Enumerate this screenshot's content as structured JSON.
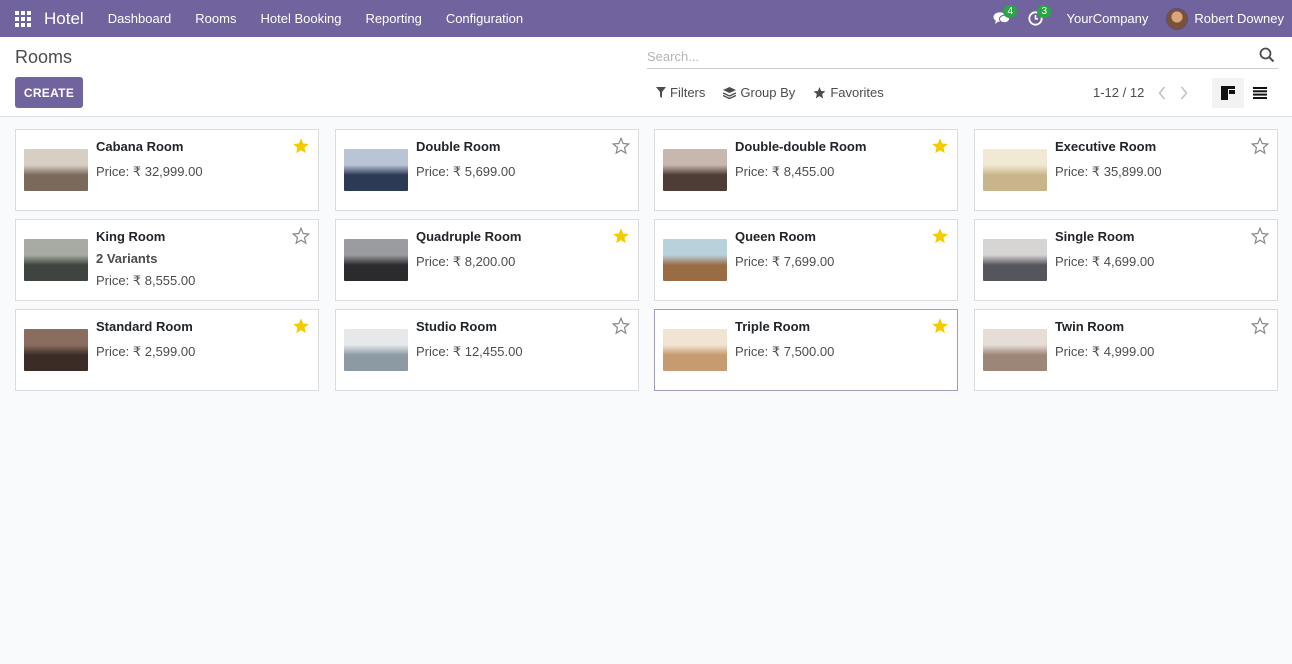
{
  "navbar": {
    "app_name": "Hotel",
    "menu": [
      "Dashboard",
      "Rooms",
      "Hotel Booking",
      "Reporting",
      "Configuration"
    ],
    "messages_count": "4",
    "activities_count": "3",
    "company": "YourCompany",
    "user": "Robert Downey",
    "accent_color": "#71639e"
  },
  "control": {
    "title": "Rooms",
    "create_label": "CREATE",
    "search_placeholder": "Search...",
    "filters_label": "Filters",
    "groupby_label": "Group By",
    "favorites_label": "Favorites",
    "pager": "1-12 / 12"
  },
  "rooms": [
    {
      "name": "Cabana Room",
      "variants": "",
      "price": "Price: ₹ 32,999.00",
      "starred": true,
      "c1": "#7b6a5c",
      "c2": "#d8cfc4"
    },
    {
      "name": "Double Room",
      "variants": "",
      "price": "Price: ₹ 5,699.00",
      "starred": false,
      "c1": "#2d3a55",
      "c2": "#b9c4d6"
    },
    {
      "name": "Double-double Room",
      "variants": "",
      "price": "Price: ₹ 8,455.00",
      "starred": true,
      "c1": "#4e3c36",
      "c2": "#c7b7ae"
    },
    {
      "name": "Executive Room",
      "variants": "",
      "price": "Price: ₹ 35,899.00",
      "starred": false,
      "c1": "#c9b58b",
      "c2": "#f1e9d4"
    },
    {
      "name": "King Room",
      "variants": "2 Variants",
      "price": "Price: ₹ 8,555.00",
      "starred": false,
      "c1": "#3f4440",
      "c2": "#a7aba3"
    },
    {
      "name": "Quadruple Room",
      "variants": "",
      "price": "Price: ₹ 8,200.00",
      "starred": true,
      "c1": "#2b2b2d",
      "c2": "#9b9ca0"
    },
    {
      "name": "Queen Room",
      "variants": "",
      "price": "Price: ₹ 7,699.00",
      "starred": true,
      "c1": "#9a6c46",
      "c2": "#b8d2dc"
    },
    {
      "name": "Single Room",
      "variants": "",
      "price": "Price: ₹ 4,699.00",
      "starred": false,
      "c1": "#55555c",
      "c2": "#d7d5d3"
    },
    {
      "name": "Standard Room",
      "variants": "",
      "price": "Price: ₹ 2,599.00",
      "starred": true,
      "c1": "#3c2c28",
      "c2": "#8a6d5e"
    },
    {
      "name": "Studio Room",
      "variants": "",
      "price": "Price: ₹ 12,455.00",
      "starred": false,
      "c1": "#8c9aa3",
      "c2": "#e6e8ea"
    },
    {
      "name": "Triple Room",
      "variants": "",
      "price": "Price: ₹ 7,500.00",
      "starred": true,
      "c1": "#c79a70",
      "c2": "#f2e4d2"
    },
    {
      "name": "Twin Room",
      "variants": "",
      "price": "Price: ₹ 4,999.00",
      "starred": false,
      "c1": "#9d8577",
      "c2": "#e6ddd6"
    }
  ]
}
